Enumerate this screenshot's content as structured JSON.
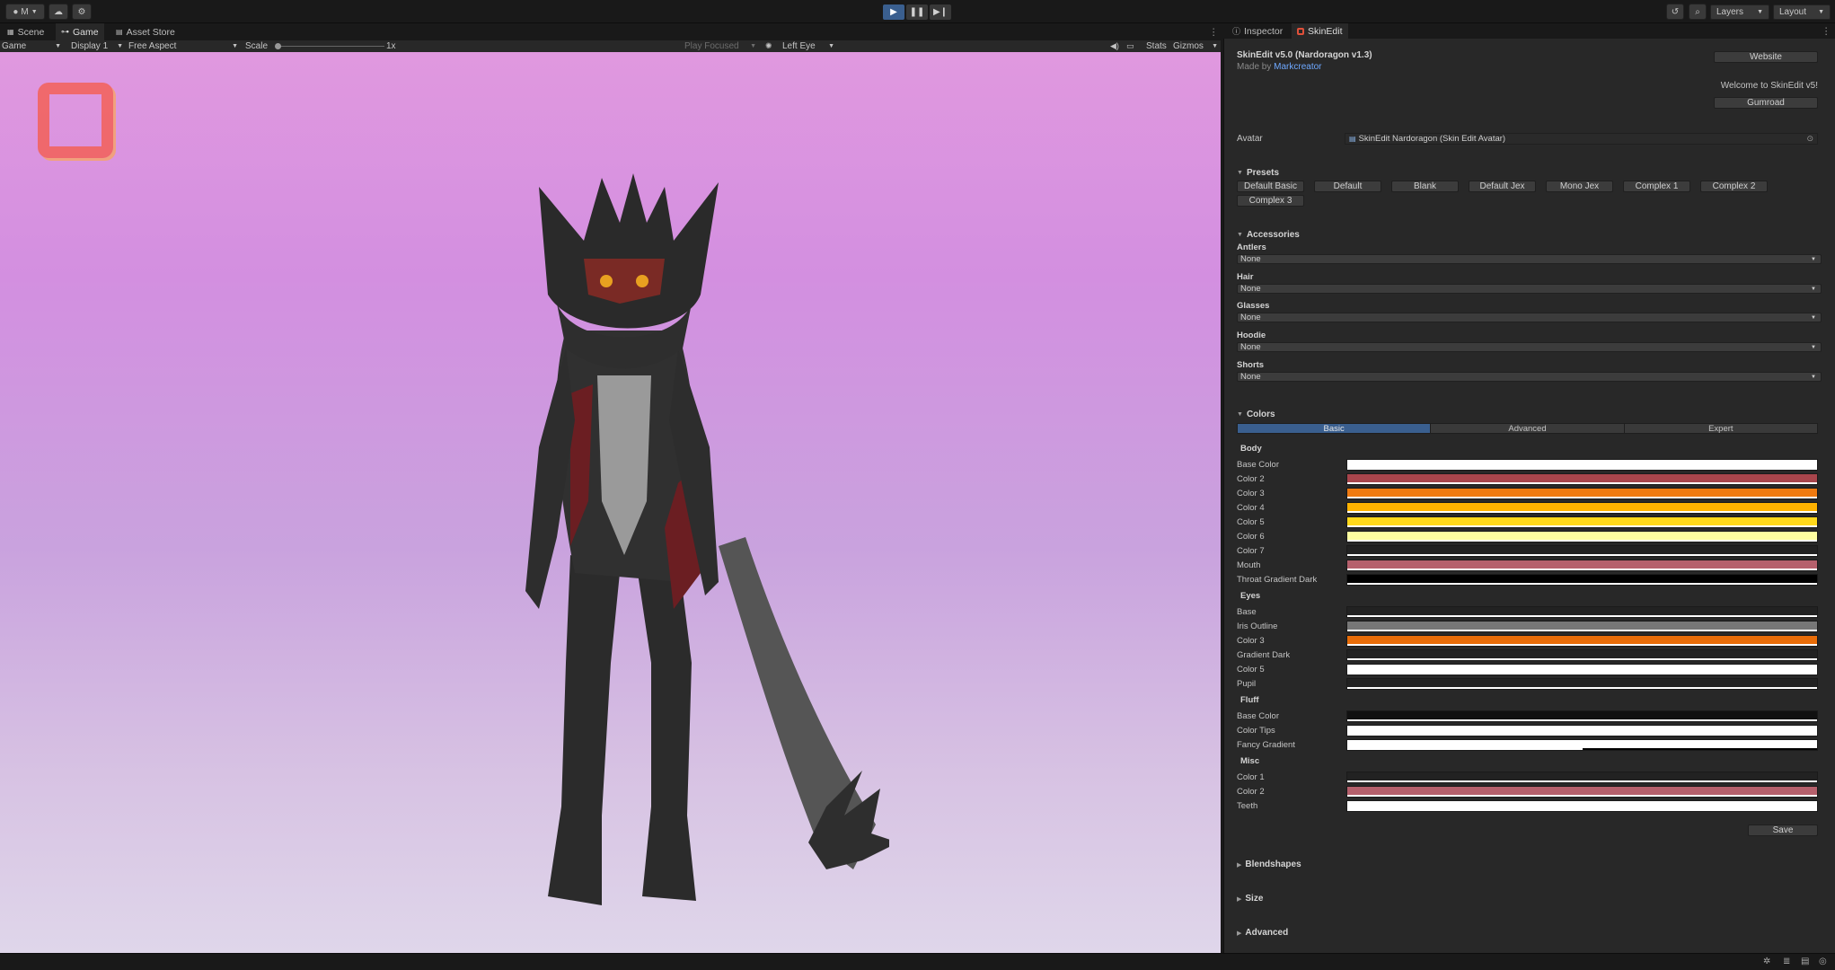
{
  "toolbar": {
    "account_label": "M",
    "layers_label": "Layers",
    "layout_label": "Layout"
  },
  "game_panel": {
    "tabs": [
      {
        "label": "Scene",
        "icon": "grid-icon"
      },
      {
        "label": "Game",
        "icon": "gamepad-icon"
      },
      {
        "label": "Asset Store",
        "icon": "store-icon"
      }
    ],
    "view_dropdown": "Game",
    "display_dropdown": "Display 1",
    "aspect_dropdown": "Free Aspect",
    "scale_label": "Scale",
    "scale_value": "1x",
    "play_focused": "Play Focused",
    "eye_dropdown": "Left Eye",
    "stats_label": "Stats",
    "gizmos_label": "Gizmos"
  },
  "inspector": {
    "tabs": [
      {
        "label": "Inspector",
        "icon": "info-icon"
      },
      {
        "label": "SkinEdit",
        "icon": "skinedit-icon"
      }
    ],
    "title": "SkinEdit v5.0 (Nardoragon v1.3)",
    "made_by_prefix": "Made by",
    "made_by_author": "Markcreator",
    "website_button": "Website",
    "welcome_text": "Welcome to SkinEdit v5!",
    "gumroad_button": "Gumroad",
    "avatar_label": "Avatar",
    "avatar_value": "SkinEdit Nardoragon (Skin Edit Avatar)",
    "presets_header": "Presets",
    "presets": [
      "Default Basic",
      "Default",
      "Blank",
      "Default Jex",
      "Mono Jex",
      "Complex 1",
      "Complex 2",
      "Complex 3"
    ],
    "accessories_header": "Accessories",
    "accessories": [
      {
        "label": "Antlers",
        "value": "None"
      },
      {
        "label": "Hair",
        "value": "None"
      },
      {
        "label": "Glasses",
        "value": "None"
      },
      {
        "label": "Hoodie",
        "value": "None"
      },
      {
        "label": "Shorts",
        "value": "None"
      }
    ],
    "colors_header": "Colors",
    "color_tabs": [
      "Basic",
      "Advanced",
      "Expert"
    ],
    "color_groups": [
      {
        "name": "Body",
        "items": [
          {
            "label": "Base Color",
            "color": "#ffffff",
            "alpha": 1.0
          },
          {
            "label": "Color 2",
            "color": "#a8454c",
            "alpha": 1.0
          },
          {
            "label": "Color 3",
            "color": "#f07a10",
            "alpha": 1.0
          },
          {
            "label": "Color 4",
            "color": "#ffb300",
            "alpha": 1.0
          },
          {
            "label": "Color 5",
            "color": "#ffd81a",
            "alpha": 1.0
          },
          {
            "label": "Color 6",
            "color": "#ffffa0",
            "alpha": 1.0
          },
          {
            "label": "Color 7",
            "color": "#222222",
            "alpha": 1.0
          },
          {
            "label": "Mouth",
            "color": "#b5606c",
            "alpha": 1.0
          },
          {
            "label": "Throat Gradient Dark",
            "color": "#000000",
            "alpha": 1.0
          }
        ]
      },
      {
        "name": "Eyes",
        "items": [
          {
            "label": "Base",
            "color": "#222222",
            "alpha": 1.0
          },
          {
            "label": "Iris Outline",
            "color": "#777777",
            "alpha": 1.0
          },
          {
            "label": "Color 3",
            "color": "#e86c08",
            "alpha": 1.0
          },
          {
            "label": "Gradient Dark",
            "color": "#222222",
            "alpha": 1.0
          },
          {
            "label": "Color 5",
            "color": "#ffffff",
            "alpha": 1.0
          },
          {
            "label": "Pupil",
            "color": "#222222",
            "alpha": 1.0
          }
        ]
      },
      {
        "name": "Fluff",
        "items": [
          {
            "label": "Base Color",
            "color": "#111111",
            "alpha": 1.0
          },
          {
            "label": "Color Tips",
            "color": "#ffffff",
            "alpha": 1.0
          },
          {
            "label": "Fancy Gradient",
            "color": "#ffffff",
            "alpha": 0.5
          }
        ]
      },
      {
        "name": "Misc",
        "items": [
          {
            "label": "Color 1",
            "color": "#222222",
            "alpha": 1.0
          },
          {
            "label": "Color 2",
            "color": "#b5606c",
            "alpha": 1.0
          },
          {
            "label": "Teeth",
            "color": "#ffffff",
            "alpha": 1.0
          }
        ]
      }
    ],
    "save_button": "Save",
    "collapsed_sections": [
      "Blendshapes",
      "Size",
      "Advanced"
    ]
  },
  "colors": {
    "accent": "#3a5f8f",
    "link": "#6ea8ff",
    "panel": "#282828"
  }
}
